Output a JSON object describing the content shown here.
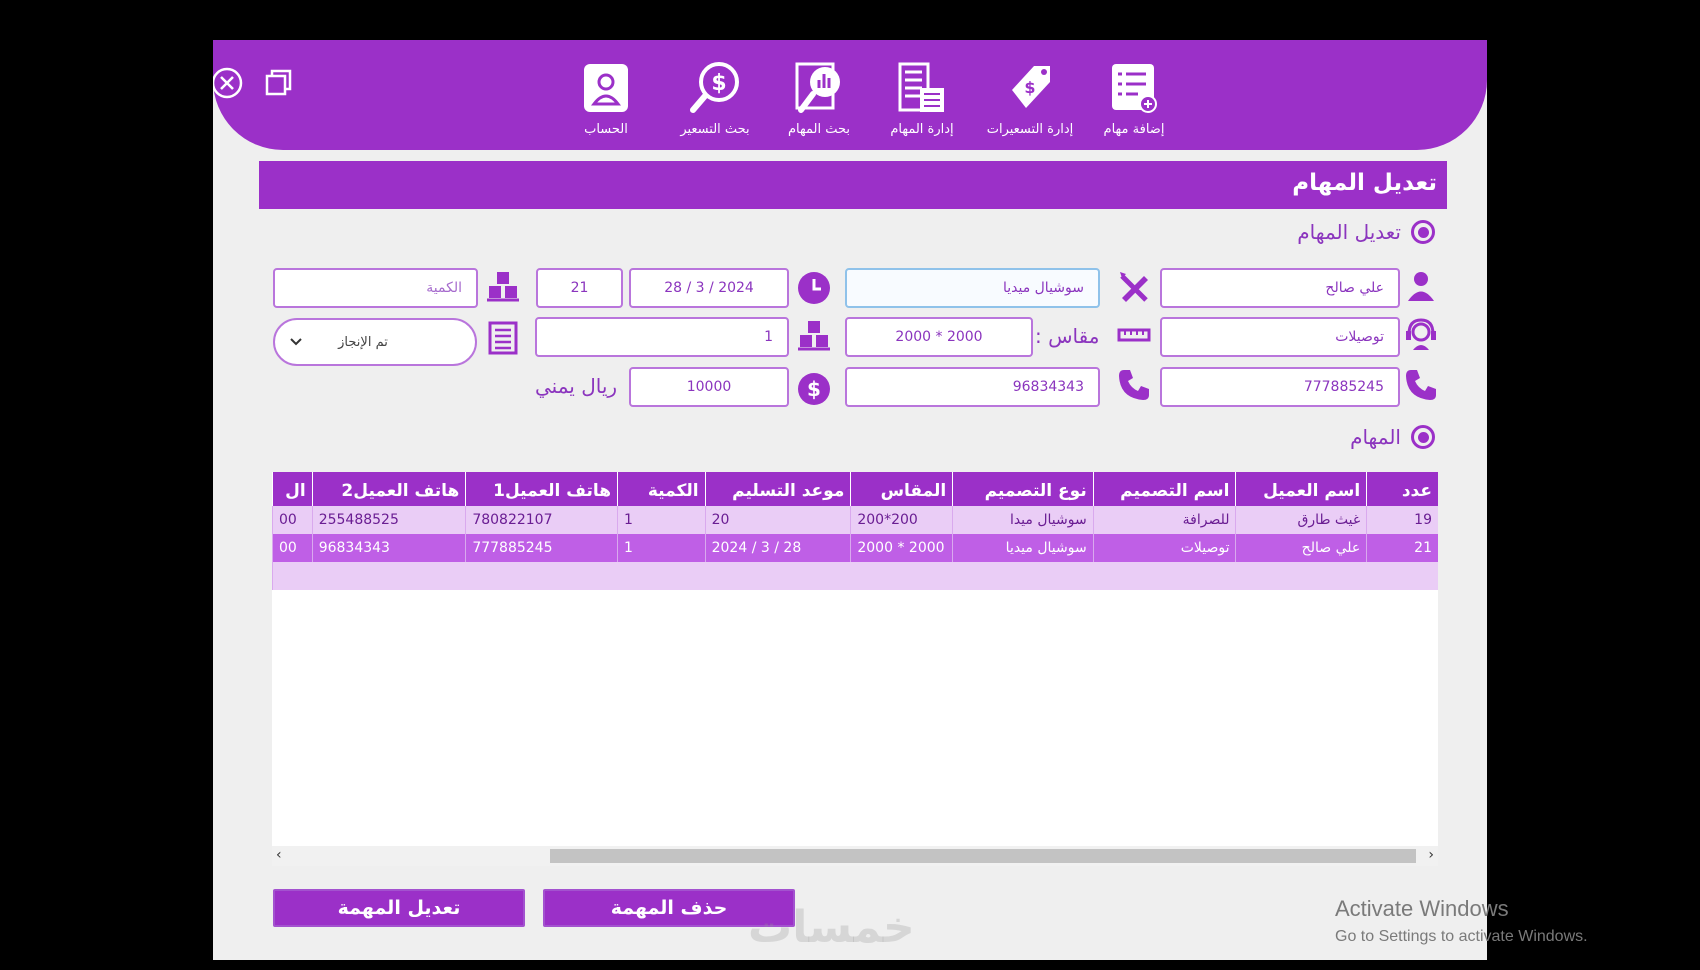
{
  "nav": {
    "items": [
      {
        "label": "الحساب",
        "icon": "user-id-icon"
      },
      {
        "label": "بحث التسعير",
        "icon": "price-search-icon"
      },
      {
        "label": "بحث المهام",
        "icon": "task-search-icon"
      },
      {
        "label": "إدارة المهام",
        "icon": "task-management-icon"
      },
      {
        "label": "إدارة التسعيرات",
        "icon": "price-tag-icon"
      },
      {
        "label": "إضافة مهام",
        "icon": "add-task-icon"
      }
    ]
  },
  "page": {
    "title": "تعديل المهام",
    "section_edit": "تعديل المهام",
    "section_tasks": "المهام"
  },
  "form": {
    "customer_name": "علي صالح",
    "design_name": "توصيلات",
    "phone1": "777885245",
    "design_type": "سوشيال ميديا",
    "size_label": "مقاس :",
    "size": "2000 * 2000",
    "phone2": "96834343",
    "date": "2024 / 3 / 28",
    "id": "21",
    "quantity_placeholder": "الكمية",
    "quantity": "1",
    "price": "10000",
    "currency": "ريال يمني",
    "status": "تم الإنجاز"
  },
  "table": {
    "headers": [
      "عدد",
      "اسم العميل",
      "اسم التصميم",
      "نوع التصميم",
      "المقاس",
      "موعد التسليم",
      "الكمية",
      "هاتف العميل1",
      "هاتف العميل2",
      "ال"
    ],
    "rows": [
      [
        "19",
        "غيث طارق",
        "للصرافة",
        "سوشيال ميدا",
        "200*200",
        "20",
        "1",
        "780822107",
        "255488525",
        "00"
      ],
      [
        "21",
        "علي صالح",
        "توصيلات",
        "سوشيال ميديا",
        "2000 * 2000",
        "28 / 3 / 2024",
        "1",
        "777885245",
        "96834343",
        "00"
      ]
    ]
  },
  "buttons": {
    "delete": "حذف المهمة",
    "edit": "تعديل المهمة"
  },
  "os": {
    "activate_title": "Activate Windows",
    "activate_sub": "Go to Settings to activate Windows."
  },
  "watermark": "خمسات",
  "colors": {
    "accent": "#9b30c8",
    "row_highlight": "#bf5fe6",
    "row_light": "#eacdf6"
  }
}
